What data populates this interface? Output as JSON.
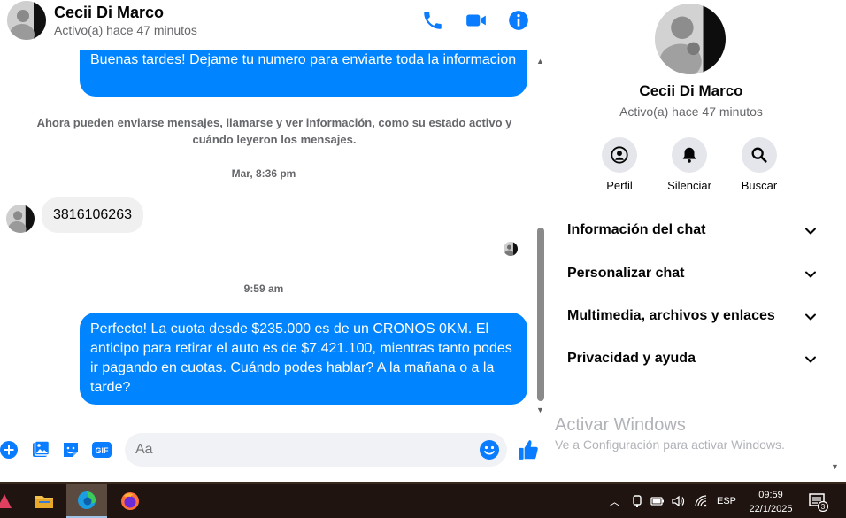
{
  "header": {
    "name": "Cecii Di Marco",
    "status": "Activo(a) hace 47 minutos",
    "icons": [
      "phone-icon",
      "video-icon",
      "info-icon"
    ]
  },
  "messages": {
    "outgoing_1": "Buenas tardes! Dejame tu numero para enviarte toda la informacion",
    "system_note": "Ahora pueden enviarse mensajes, llamarse y ver información, como su estado activo y cuándo leyeron los mensajes.",
    "time_1": "Mar, 8:36 pm",
    "incoming_1": "3816106263",
    "time_2": "9:59 am",
    "outgoing_2": "Perfecto! La cuota desde $235.000 es de un CRONOS 0KM. El anticipo para retirar el auto es de $7.421.100, mientras tanto podes ir pagando en cuotas. Cuándo podes hablar? A la mañana o a la tarde?"
  },
  "composer": {
    "placeholder": "Aa",
    "icons": [
      "plus-icon",
      "image-icon",
      "sticker-icon",
      "gif-icon",
      "emoji-icon",
      "like-icon"
    ],
    "gif_label": "GIF"
  },
  "panel": {
    "name": "Cecii Di Marco",
    "status": "Activo(a) hace 47 minutos",
    "actions": [
      {
        "label": "Perfil",
        "icon": "profile-icon"
      },
      {
        "label": "Silenciar",
        "icon": "bell-icon"
      },
      {
        "label": "Buscar",
        "icon": "search-icon"
      }
    ],
    "sections": [
      {
        "label": "Información del chat"
      },
      {
        "label": "Personalizar chat"
      },
      {
        "label": "Multimedia, archivos y enlaces"
      },
      {
        "label": "Privacidad y ayuda"
      }
    ],
    "watermark_title": "Activar Windows",
    "watermark_sub": "Ve a Configuración para activar Windows."
  },
  "taskbar": {
    "apps": [
      "partial-app-icon",
      "file-explorer-icon",
      "edge-icon",
      "firefox-icon"
    ],
    "language": "ESP",
    "time": "09:59",
    "date": "22/1/2025",
    "notification_count": "3"
  },
  "colors": {
    "messenger_blue": "#0084ff",
    "icon_blue": "#0a7cff"
  }
}
